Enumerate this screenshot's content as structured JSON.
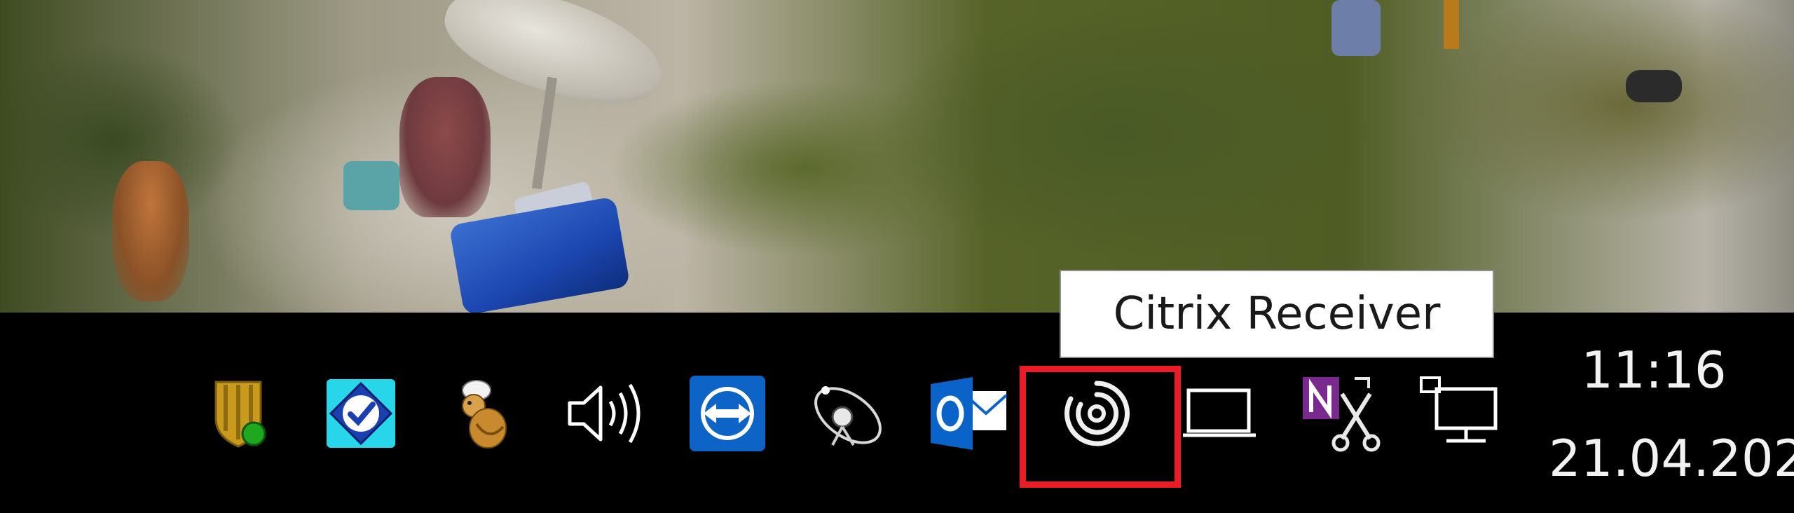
{
  "tooltip": {
    "text": "Citrix Receiver"
  },
  "clock": {
    "time": "11:16",
    "date": "21.04.202"
  },
  "tray": {
    "icons": [
      "security-shield-icon",
      "checkmark-app-icon",
      "cartoon-mascot-icon",
      "speaker-volume-icon",
      "teamviewer-icon",
      "satellite-dish-icon",
      "outlook-icon",
      "citrix-receiver-icon",
      "display-icon",
      "onenote-send-to-icon",
      "network-icon"
    ],
    "highlighted_icon": "citrix-receiver-icon"
  },
  "colors": {
    "taskbar": "#000000",
    "highlight_border": "#ec1c24",
    "tooltip_bg": "#ffffff",
    "teamviewer": "#0e63c6",
    "outlook": "#0a63c8",
    "onenote": "#7a2a8f",
    "shield_gold": "#c99a1c",
    "status_green": "#1fa81f"
  }
}
